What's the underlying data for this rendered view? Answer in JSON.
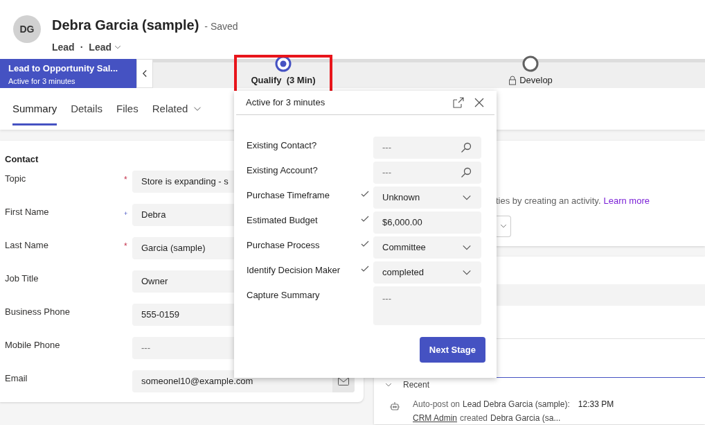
{
  "record": {
    "initials": "DG",
    "title": "Debra Garcia (sample)",
    "save_status": "- Saved",
    "entity": "Lead",
    "separator": "·",
    "form": "Lead"
  },
  "process": {
    "name": "Lead to Opportunity Sal...",
    "status": "Active for 3 minutes",
    "stages": [
      {
        "label": "Qualify  (3 Min)",
        "selected": true,
        "locked": false,
        "highlighted": true
      },
      {
        "label": "Develop",
        "selected": false,
        "locked": true,
        "highlighted": false
      }
    ]
  },
  "tabs": [
    {
      "label": "Summary",
      "selected": true,
      "kind": "tab"
    },
    {
      "label": "Details",
      "selected": false,
      "kind": "tab"
    },
    {
      "label": "Files",
      "selected": false,
      "kind": "tab"
    },
    {
      "label": "Related",
      "selected": false,
      "kind": "dropdown"
    }
  ],
  "contact": {
    "heading": "Contact",
    "fields": [
      {
        "label": "Topic",
        "marker": "*",
        "recommended": false,
        "value": "Store is expanding - s",
        "kind": "text"
      },
      {
        "label": "First Name",
        "marker": "+",
        "recommended": true,
        "value": "Debra",
        "kind": "text"
      },
      {
        "label": "Last Name",
        "marker": "*",
        "recommended": false,
        "value": "Garcia (sample)",
        "kind": "text"
      },
      {
        "label": "Job Title",
        "value": "Owner",
        "kind": "text"
      },
      {
        "label": "Business Phone",
        "value": "555-0159",
        "kind": "text"
      },
      {
        "label": "Mobile Phone",
        "placeholder": "---",
        "kind": "text"
      },
      {
        "label": "Email",
        "value": "someonel10@example.com",
        "kind": "email"
      }
    ]
  },
  "stage_flyout": {
    "status": "Active for 3 minutes",
    "steps": [
      {
        "label": "Existing Contact?",
        "done": false,
        "kind": "lookup",
        "placeholder": "---"
      },
      {
        "label": "Existing Account?",
        "done": false,
        "kind": "lookup",
        "placeholder": "---"
      },
      {
        "label": "Purchase Timeframe",
        "done": true,
        "kind": "select",
        "value": "Unknown"
      },
      {
        "label": "Estimated Budget",
        "done": true,
        "kind": "text",
        "value": "$6,000.00"
      },
      {
        "label": "Purchase Process",
        "done": true,
        "kind": "select",
        "value": "Committee"
      },
      {
        "label": "Identify Decision Maker",
        "done": true,
        "kind": "select",
        "value": "completed"
      },
      {
        "label": "Capture Summary",
        "done": false,
        "kind": "multiline",
        "placeholder": "---"
      }
    ],
    "next_button": "Next Stage"
  },
  "timeline": {
    "hint": "ties by creating an activity.",
    "hint_link": "Learn more",
    "section": "Recent",
    "post": {
      "prefix": "Auto-post on",
      "subject": "Lead Debra Garcia (sample):",
      "time": "12:33 PM",
      "author": "CRM Admin",
      "action": "created",
      "object": "Debra Garcia (sa..."
    }
  }
}
